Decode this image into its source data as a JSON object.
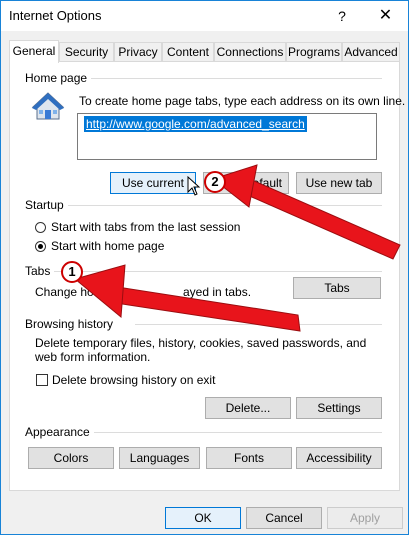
{
  "window": {
    "title": "Internet Options",
    "help_glyph": "?",
    "close_glyph": "✕"
  },
  "tabs": [
    {
      "label": "General",
      "active": true
    },
    {
      "label": "Security"
    },
    {
      "label": "Privacy"
    },
    {
      "label": "Content"
    },
    {
      "label": "Connections"
    },
    {
      "label": "Programs"
    },
    {
      "label": "Advanced"
    }
  ],
  "home_page": {
    "title": "Home page",
    "description": "To create home page tabs, type each address on its own line.",
    "url": "http://www.google.com/advanced_search",
    "use_current": "Use current",
    "use_default": "se default",
    "use_new_tab": "Use new tab",
    "icon": "house-icon"
  },
  "startup": {
    "title": "Startup",
    "option1": "Start with tabs from the last session",
    "option2": "Start with home page",
    "selected": "option2"
  },
  "tabs_group": {
    "title": "Tabs",
    "description_left": "Change how we",
    "description_right": "ayed in tabs.",
    "button": "Tabs"
  },
  "browsing_history": {
    "title": "Browsing history",
    "description": "Delete temporary files, history, cookies, saved passwords, and web form information.",
    "checkbox_label": "Delete browsing history on exit",
    "checked": false,
    "delete_button": "Delete...",
    "settings_button": "Settings"
  },
  "appearance": {
    "title": "Appearance",
    "colors": "Colors",
    "languages": "Languages",
    "fonts": "Fonts",
    "accessibility": "Accessibility"
  },
  "footer": {
    "ok": "OK",
    "cancel": "Cancel",
    "apply": "Apply"
  },
  "annotations": {
    "badge1": "1",
    "badge2": "2",
    "arrow_color": "#e8141b"
  }
}
